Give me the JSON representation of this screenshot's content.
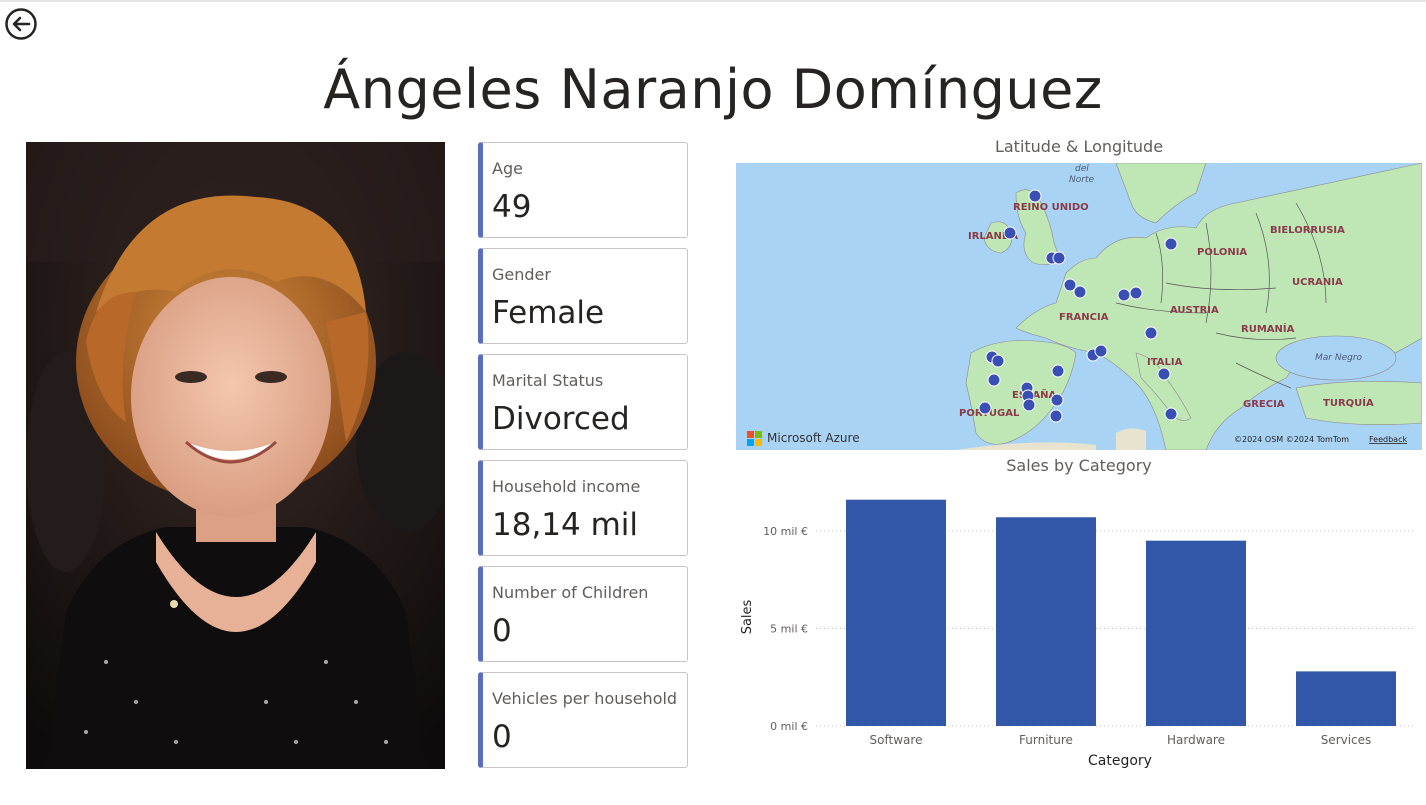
{
  "page": {
    "title": "Ángeles Naranjo Domínguez"
  },
  "nav": {
    "back_icon": "back-arrow-icon"
  },
  "photo": {
    "description_icon": "profile-photo"
  },
  "cards": [
    {
      "label": "Age",
      "value": "49"
    },
    {
      "label": "Gender",
      "value": "Female"
    },
    {
      "label": "Marital Status",
      "value": "Divorced"
    },
    {
      "label": "Household income",
      "value": "18,14 mil"
    },
    {
      "label": "Number of Children",
      "value": "0"
    },
    {
      "label": "Vehicles per household",
      "value": "0"
    }
  ],
  "map": {
    "title": "Latitude & Longitude",
    "brand": "Microsoft Azure",
    "attribution": "©2024 OSM  ©2024 TomTom",
    "feedback": "Feedback",
    "labels": {
      "reino_unido": "REINO UNIDO",
      "irlanda": "IRLANDA",
      "polonia": "POLONIA",
      "bielorrusia": "BIELORRUSIA",
      "ucrania": "UCRANIA",
      "francia": "FRANCIA",
      "austria": "AUSTRIA",
      "rumania": "RUMANÍA",
      "mar_negro": "Mar Negro",
      "italia": "ITALIA",
      "espana": "ESPAÑA",
      "portugal": "PORTUGAL",
      "grecia": "GRECIA",
      "turquia": "TURQUÍA",
      "del": "del",
      "norte": "Norte"
    },
    "colors": {
      "water": "#a9d3f5",
      "land": "#bfe6b5",
      "marker": "#3a4fb5"
    }
  },
  "chart_data": {
    "type": "bar",
    "title": "Sales by Category",
    "xlabel": "Category",
    "ylabel": "Sales",
    "categories": [
      "Software",
      "Furniture",
      "Hardware",
      "Services"
    ],
    "values": [
      11600,
      10700,
      9500,
      2800
    ],
    "ylim": [
      0,
      12200
    ],
    "yticks": [
      0,
      5000,
      10000
    ],
    "ytick_labels": [
      "0 mil €",
      "5 mil €",
      "10 mil €"
    ],
    "grid": true,
    "color": "#3257a8"
  }
}
